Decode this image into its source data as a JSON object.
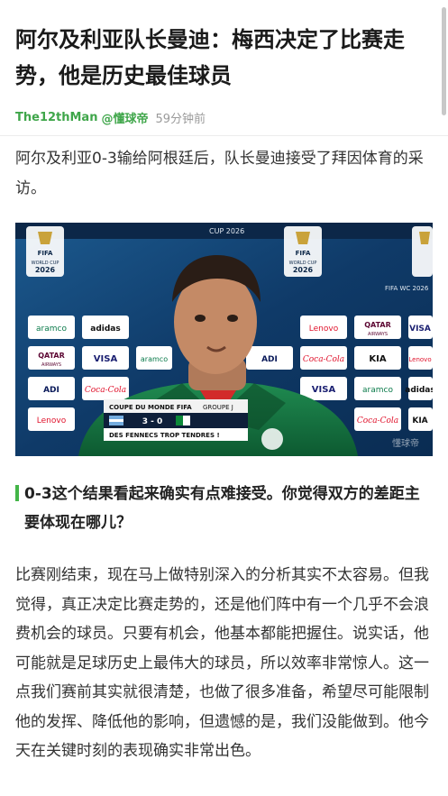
{
  "article": {
    "title": "阿尔及利亚队长曼迪：梅西决定了比赛走势，他是历史最佳球员",
    "author": "The12thMan",
    "source": "@懂球帝",
    "time": "59分钟前",
    "intro": "阿尔及利亚0-3输给阿根廷后，队长曼迪接受了拜因体育的采访。",
    "question": "0-3这个结果看起来确实有点难接受。你觉得双方的差距主要体现在哪儿？",
    "answer": "比赛刚结束，现在马上做特别深入的分析其实不太容易。但我觉得，真正决定比赛走势的，还是他们阵中有一个几乎不会浪费机会的球员。只要有机会，他基本都能把握住。说实话，他可能就是足球历史上最伟大的球员，所以效率非常惊人。这一点我们赛前其实就很清楚，也做了很多准备，希望尽可能限制他的发挥、降低他的影响，但遗憾的是，我们没能做到。他今天在关键时刻的表现确实非常出色。"
  },
  "photo": {
    "cup_label": "CUP 2026",
    "fifa": "FIFA",
    "world_cup": "WORLD CUP",
    "year": "2026",
    "fifa_wc_2026": "FIFA WC 2026",
    "sponsors": {
      "aramco": "aramco",
      "adidas": "adidas",
      "kia": "KIA",
      "lenovo": "Lenovo",
      "qatar": "QATAR",
      "qatar_sub": "AIRWAYS",
      "visa": "VISA",
      "coca": "Coca-Cola",
      "adi": "ADI"
    },
    "scoreboard": {
      "competition": "COUPE DU MONDE FIFA",
      "group": "GROUPE J",
      "score": "3 - 0",
      "caption": "DES FENNECS TROP TENDRES !"
    },
    "watermark": "懂球帝"
  },
  "colors": {
    "accent_green": "#43b548",
    "brand_green": "#3fa64a"
  }
}
